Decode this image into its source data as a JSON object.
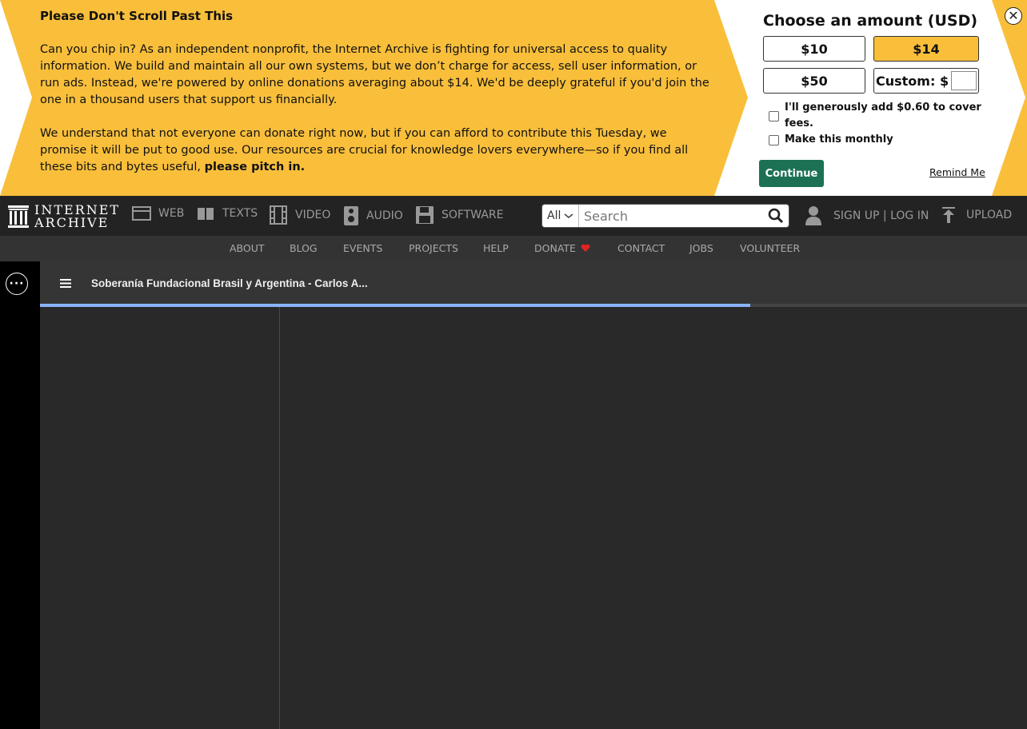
{
  "banner": {
    "title": "Please Don't Scroll Past This",
    "para1": "Can you chip in? As an independent nonprofit, the Internet Archive is fighting for universal access to quality information. We build and maintain all our own systems, but we don’t charge for access, sell user information, or run ads. Instead, we're powered by online donations averaging about $14. We'd be deeply grateful if you'd join the one in a thousand users that support us financially.",
    "para2": "We understand that not everyone can donate right now, but if you can afford to contribute this Tuesday, we promise it will be put to good use. Our resources are crucial for knowledge lovers everywhere—so if you find all these bits and bytes useful,",
    "para2_bold": "please pitch in.",
    "amount_title": "Choose an amount (USD)",
    "amounts": [
      "$10",
      "$14",
      "$50"
    ],
    "selected_amount": "$14",
    "custom_label": "Custom: $",
    "custom_value": "",
    "fees_label": "I'll generously add $0.60 to cover fees.",
    "monthly_label": "Make this monthly",
    "continue_label": "Continue",
    "remind_label": "Remind Me",
    "close_symbol": "✕"
  },
  "nav": {
    "logo_line1": "INTERNET",
    "logo_line2": "ARCHIVE",
    "items": [
      {
        "label": "WEB",
        "icon": "web-icon"
      },
      {
        "label": "TEXTS",
        "icon": "texts-icon"
      },
      {
        "label": "VIDEO",
        "icon": "video-icon"
      },
      {
        "label": "AUDIO",
        "icon": "audio-icon"
      },
      {
        "label": "SOFTWARE",
        "icon": "software-icon"
      }
    ],
    "search_scope": "All",
    "search_placeholder": "Search",
    "signup_label": "SIGN UP | LOG IN",
    "upload_label": "UPLOAD"
  },
  "subnav": {
    "items": [
      "ABOUT",
      "BLOG",
      "EVENTS",
      "PROJECTS",
      "HELP",
      "DONATE",
      "CONTACT",
      "JOBS",
      "VOLUNTEER"
    ]
  },
  "viewer": {
    "title": "Soberanía Fundacional Brasil y Argentina - Carlos A...",
    "load_progress": 0.72,
    "progress_color": "#8ab4f8"
  },
  "colors": {
    "banner_yellow": "#f9bf3b",
    "continue_green": "#1c7155",
    "donate_heart": "#e02424"
  }
}
